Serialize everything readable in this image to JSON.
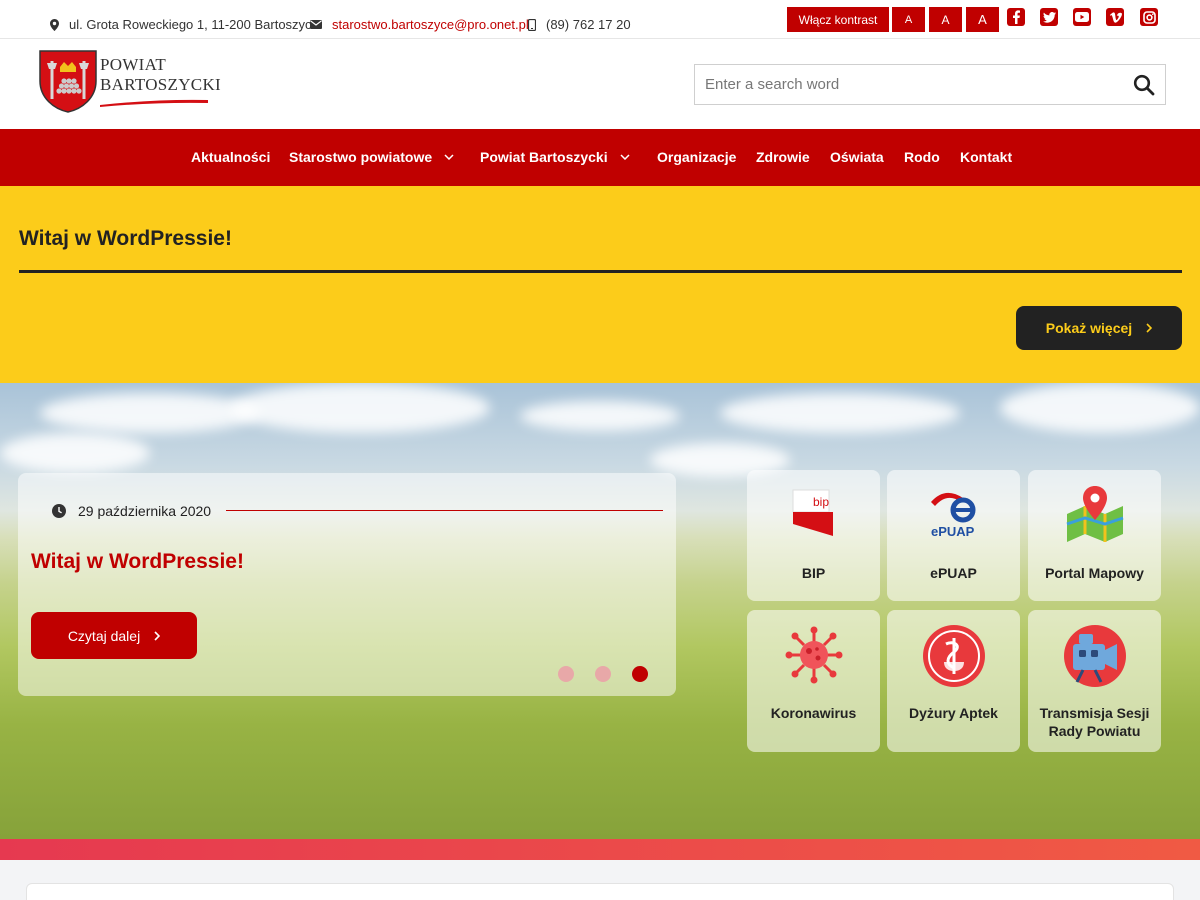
{
  "topbar": {
    "address": "ul. Grota Roweckiego 1, 11-200 Bartoszyce",
    "email": "starostwo.bartoszyce@pro.onet.pl",
    "phone": "(89) 762 17 20",
    "contrast_label": "Włącz kontrast",
    "font_sizes": [
      "A",
      "A",
      "A"
    ],
    "social_icons": [
      "facebook-icon",
      "twitter-icon",
      "youtube-icon",
      "vimeo-icon",
      "instagram-icon"
    ]
  },
  "header": {
    "logo_line1": "POWIAT",
    "logo_line2": "BARTOSZYCKI",
    "search_placeholder": "Enter a search word"
  },
  "nav": {
    "items": [
      "Aktualności",
      "Starostwo powiatowe",
      "Powiat Bartoszycki",
      "Organizacje",
      "Zdrowie",
      "Oświata",
      "Rodo",
      "Kontakt"
    ]
  },
  "featured": {
    "title": "Witaj w WordPressie!",
    "more_label": "Pokaż więcej"
  },
  "slider": {
    "date": "29 października 2020",
    "title": "Witaj w WordPressie!",
    "read_more": "Czytaj dalej",
    "active_dot": 3
  },
  "tiles": [
    {
      "label": "BIP",
      "bip_text": "bip"
    },
    {
      "label": "ePUAP",
      "epuap_text": "ePUAP"
    },
    {
      "label": "Portal Mapowy"
    },
    {
      "label": "Koronawirus"
    },
    {
      "label": "Dyżury Aptek"
    },
    {
      "label": "Transmisja Sesji Rady Powiatu"
    }
  ],
  "colors": {
    "brand_red": "#c00000",
    "accent_yellow": "#fccc1a",
    "dark": "#222222"
  }
}
